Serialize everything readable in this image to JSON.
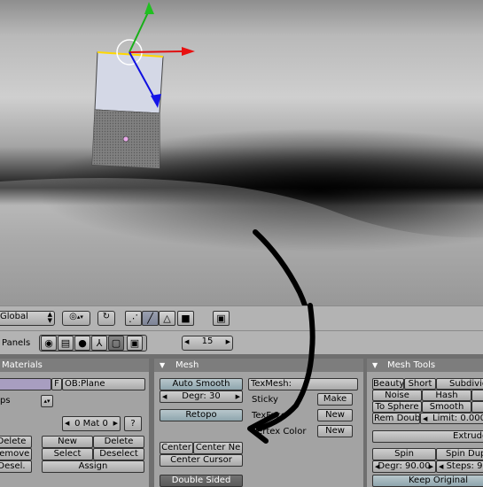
{
  "viewport_header": {
    "orientation_value": "Global",
    "layer_number": "15"
  },
  "buttons_header": {
    "panels_label": "Panels"
  },
  "materials_panel": {
    "title": "Materials",
    "f_label": "F",
    "ob_field": "OB:Plane",
    "ps_label": "ps",
    "mat_value": "0 Mat 0",
    "question": "?",
    "delete_left": "Delete",
    "new": "New",
    "delete": "Delete",
    "remove": "Remove",
    "select": "Select",
    "deselect": "Deselect",
    "desel_left": "Desel.",
    "assign": "Assign"
  },
  "mesh_panel": {
    "title": "Mesh",
    "auto_smooth": "Auto Smooth",
    "degr": "Degr: 30",
    "retopo": "Retopo",
    "texmesh": "TexMesh:",
    "sticky": "Sticky",
    "make": "Make",
    "vertex_label": "Vertex Color",
    "texture_label": "TexFace",
    "new1": "New",
    "new2": "New",
    "center": "Center",
    "center_new": "Center Ne",
    "center_cursor": "Center Cursor",
    "double_sided": "Double Sided"
  },
  "mesh_tools_panel": {
    "title": "Mesh Tools",
    "beauty": "Beauty",
    "short": "Short",
    "subdivide": "Subdivid",
    "noise": "Noise",
    "hash": "Hash",
    "to_sphere": "To Sphere",
    "smooth": "Smooth",
    "rem_doubles": "Rem Doubl",
    "limit": "Limit: 0.000",
    "extrude": "Extrude",
    "spin": "Spin",
    "spin_dup": "Spin Dup",
    "degr": "Degr: 90.00",
    "steps": "Steps: 9",
    "keep_original": "Keep Original"
  }
}
